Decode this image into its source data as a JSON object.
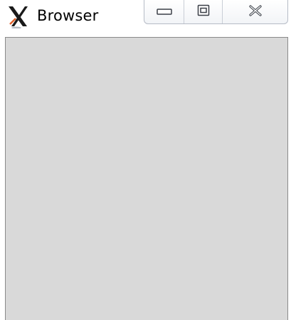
{
  "window": {
    "title": "Browser",
    "app_icon": "x-logo-icon"
  },
  "caption_buttons": {
    "minimize_icon": "minimize-icon",
    "maximize_icon": "maximize-icon",
    "close_icon": "close-icon"
  },
  "colors": {
    "client_background": "#d9d9d9",
    "window_background": "#ffffff"
  }
}
